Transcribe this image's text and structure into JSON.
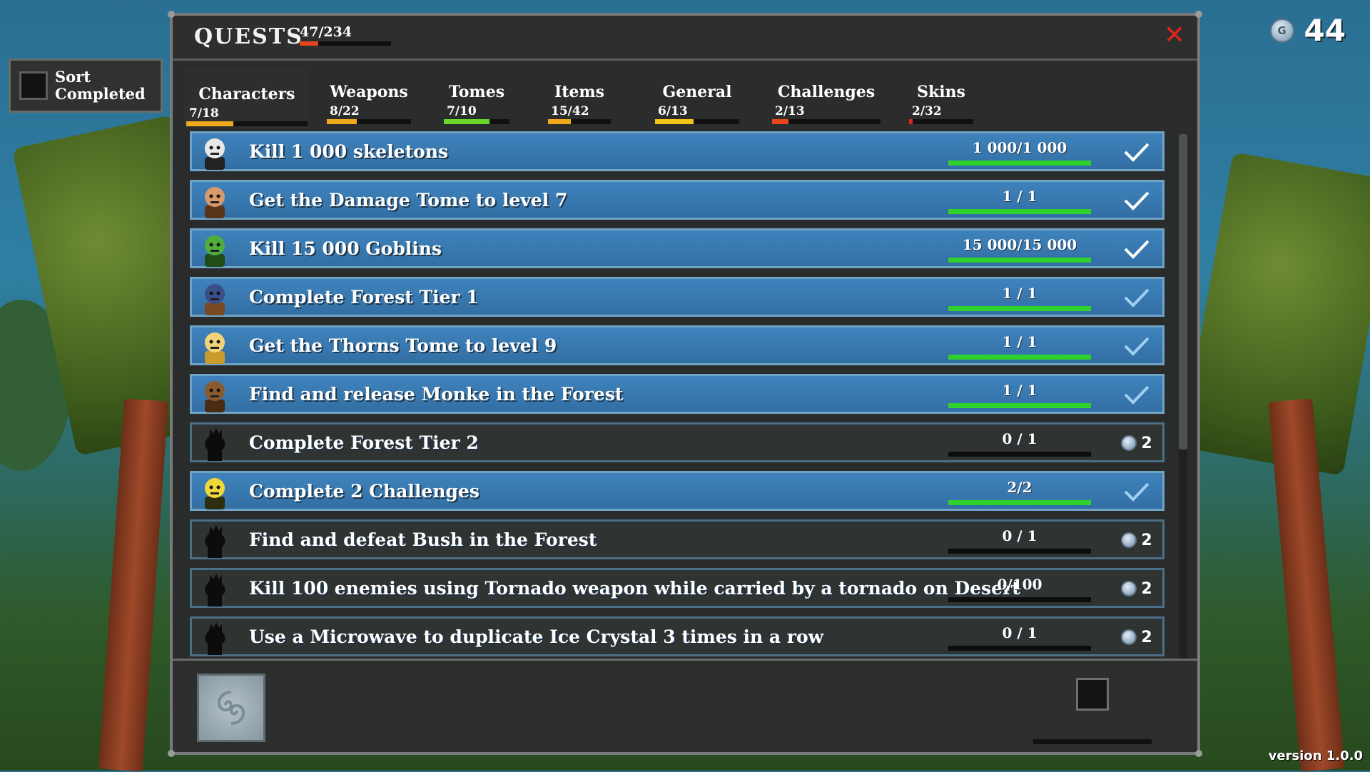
{
  "currency": {
    "value": "44",
    "icon": "coin-icon"
  },
  "version": "version 1.0.0",
  "sort": {
    "label": "Sort Completed",
    "checked": false
  },
  "panel": {
    "title": "QUESTS",
    "total_text": "47/234",
    "total_progress": 0.2,
    "close_icon": "close-icon"
  },
  "tabs": [
    {
      "label": "Characters",
      "count": "7/18",
      "progress": 0.39,
      "color": "#f0a81d",
      "active": true
    },
    {
      "label": "Weapons",
      "count": "8/22",
      "progress": 0.36,
      "color": "#f0a81d",
      "active": false
    },
    {
      "label": "Tomes",
      "count": "7/10",
      "progress": 0.7,
      "color": "#6ad62b",
      "active": false
    },
    {
      "label": "Items",
      "count": "15/42",
      "progress": 0.36,
      "color": "#f0a81d",
      "active": false
    },
    {
      "label": "General",
      "count": "6/13",
      "progress": 0.46,
      "color": "#f0c419",
      "active": false
    },
    {
      "label": "Challenges",
      "count": "2/13",
      "progress": 0.15,
      "color": "#e8451c",
      "active": false
    },
    {
      "label": "Skins",
      "count": "2/32",
      "progress": 0.06,
      "color": "#e02418",
      "active": false
    }
  ],
  "quests": [
    {
      "text": "Kill 1 000 skeletons",
      "progress_text": "1 000/1 000",
      "progress": 1,
      "done": true,
      "reward": "",
      "portrait": "skeleton-portrait-icon"
    },
    {
      "text": "Get the Damage Tome to level 7",
      "progress_text": "1 / 1",
      "progress": 1,
      "done": true,
      "reward": "",
      "portrait": "bearded-man-portrait-icon"
    },
    {
      "text": "Kill 15 000 Goblins",
      "progress_text": "15 000/15 000",
      "progress": 1,
      "done": true,
      "reward": "",
      "portrait": "goblin-portrait-icon"
    },
    {
      "text": "Complete Forest Tier 1",
      "progress_text": "1 / 1",
      "progress": 1,
      "done": true,
      "reward": "",
      "portrait": "cowboy-portrait-icon"
    },
    {
      "text": "Get the Thorns Tome to level 9",
      "progress_text": "1 / 1",
      "progress": 1,
      "done": true,
      "reward": "",
      "portrait": "viking-portrait-icon"
    },
    {
      "text": "Find and release Monke in the Forest",
      "progress_text": "1 / 1",
      "progress": 1,
      "done": true,
      "reward": "",
      "portrait": "monkey-portrait-icon"
    },
    {
      "text": "Complete Forest Tier 2",
      "progress_text": "0 / 1",
      "progress": 0,
      "done": false,
      "reward": "2",
      "portrait": "locked-silhouette-icon"
    },
    {
      "text": "Complete 2 Challenges",
      "progress_text": "2/2",
      "progress": 1,
      "done": true,
      "reward": "",
      "portrait": "hooded-figure-portrait-icon"
    },
    {
      "text": "Find and defeat Bush in the Forest",
      "progress_text": "0 / 1",
      "progress": 0,
      "done": false,
      "reward": "2",
      "portrait": "locked-silhouette-icon"
    },
    {
      "text": "Kill 100 enemies using Tornado weapon while carried by a tornado on Desert",
      "progress_text": "0/100",
      "progress": 0,
      "done": false,
      "reward": "2",
      "portrait": "locked-silhouette-icon"
    },
    {
      "text": "Use a Microwave to duplicate Ice Crystal 3 times in a row",
      "progress_text": "0 / 1",
      "progress": 0,
      "done": false,
      "reward": "2",
      "portrait": "locked-silhouette-icon"
    }
  ],
  "colors": {
    "done_row": "#3777ae",
    "todo_row": "#2f3332",
    "progress_done": "#2fd12b",
    "total_bar": "#e8451c"
  }
}
